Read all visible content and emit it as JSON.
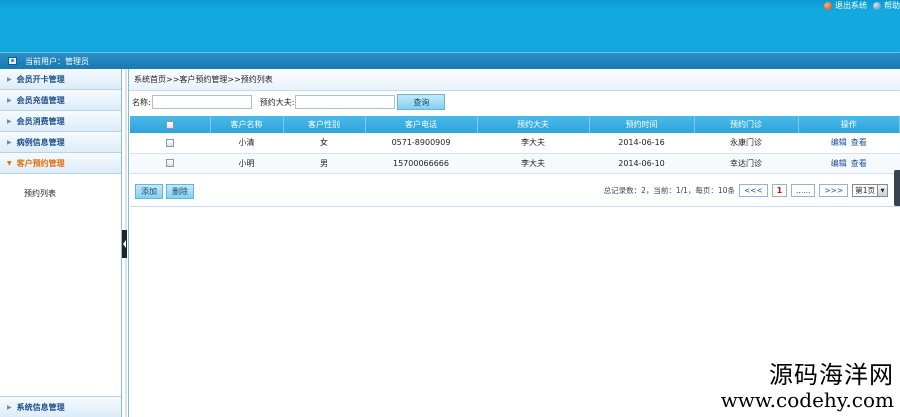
{
  "header": {
    "logout_label": "退出系统",
    "help_label": "帮助"
  },
  "userbar": {
    "text": "当前用户：管理员"
  },
  "sidebar": {
    "items": [
      {
        "label": "会员开卡管理"
      },
      {
        "label": "会员充值管理"
      },
      {
        "label": "会员消费管理"
      },
      {
        "label": "病例信息管理"
      },
      {
        "label": "客户预约管理"
      }
    ],
    "submenu": [
      "预约列表"
    ],
    "bottom_item": "系统信息管理"
  },
  "main": {
    "breadcrumb": "系统首页>>客户预约管理>>预约列表",
    "search": {
      "name_label": "名称:",
      "name_value": "",
      "doctor_label": "预约大夫:",
      "doctor_value": "",
      "button_label": "查询"
    },
    "table": {
      "columns": [
        "",
        "客户名称",
        "客户性别",
        "客户电话",
        "预约大夫",
        "预约时间",
        "预约门诊",
        "操作"
      ],
      "rows": [
        {
          "name": "小清",
          "gender": "女",
          "phone": "0571-8900909",
          "doctor": "李大夫",
          "time": "2014-06-16",
          "clinic": "永康门诊",
          "edit": "编辑",
          "view": "查看"
        },
        {
          "name": "小明",
          "gender": "男",
          "phone": "15700066666",
          "doctor": "李大夫",
          "time": "2014-06-10",
          "clinic": "幸达门诊",
          "edit": "编辑",
          "view": "查看"
        }
      ]
    },
    "actions": {
      "add_label": "添加",
      "delete_label": "删除"
    },
    "pager": {
      "summary": "总记录数：2，当前：1/1，每页：10条",
      "prev": "<<<",
      "current": "1",
      "ellipsis": "......",
      "next": ">>>",
      "page_select": "第1页"
    }
  },
  "watermark": {
    "line1": "源码海洋网",
    "line2": "www.codehy.com"
  }
}
